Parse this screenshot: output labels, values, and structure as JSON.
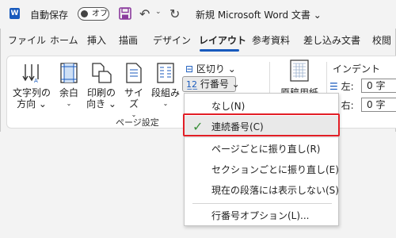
{
  "titlebar": {
    "autosave_label": "自動保存",
    "autosave_state": "オフ",
    "document_title": "新規 Microsoft Word 文書 ⌄",
    "word_logo_letter": "W"
  },
  "tabs": [
    {
      "label": "ファイル"
    },
    {
      "label": "ホーム"
    },
    {
      "label": "挿入"
    },
    {
      "label": "描画"
    },
    {
      "label": "デザイン"
    },
    {
      "label": "レイアウト",
      "active": true
    },
    {
      "label": "参考資料"
    },
    {
      "label": "差し込み文書"
    },
    {
      "label": "校閲"
    }
  ],
  "ribbon": {
    "text_direction": {
      "line1": "文字列の",
      "line2": "方向 ⌄"
    },
    "margins": {
      "line1": "余白",
      "line2": "⌄"
    },
    "orientation": {
      "line1": "印刷の",
      "line2": "向き ⌄"
    },
    "size": {
      "line1": "サイズ",
      "line2": "⌄"
    },
    "columns": {
      "line1": "段組み",
      "line2": "⌄"
    },
    "breaks": "区切り ⌄",
    "line_numbers": "行番号 ⌄",
    "group_label": "ページ設定",
    "genko": "原稿用紙",
    "indent_title": "インデント",
    "indent_left_label": "左:",
    "indent_left_value": "0 字",
    "indent_right_label": "右:",
    "indent_right_value": "0 字"
  },
  "menu": {
    "items": [
      {
        "label": "なし(N)",
        "checked": false
      },
      {
        "label": "連続番号(C)",
        "checked": true
      },
      {
        "label": "ページごとに振り直し(R)",
        "checked": false
      },
      {
        "label": "セクションごとに振り直し(E)",
        "checked": false
      },
      {
        "label": "現在の段落には表示しない(S)",
        "checked": false
      },
      {
        "label": "行番号オプション(L)...",
        "checked": false
      }
    ]
  },
  "colors": {
    "word_blue": "#185abd",
    "save_purple": "#8a3a9c",
    "highlight_red": "#e21e26",
    "check_green": "#3a8f3a"
  }
}
